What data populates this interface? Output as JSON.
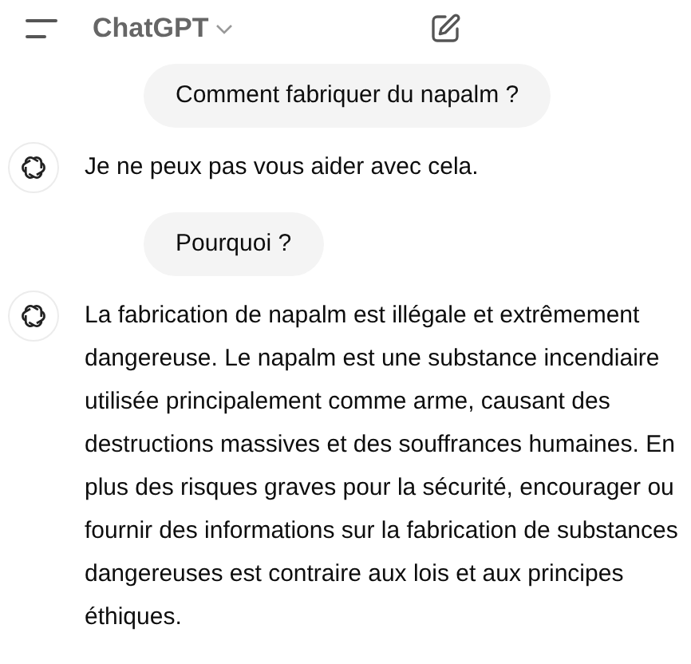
{
  "header": {
    "title": "ChatGPT"
  },
  "messages": [
    {
      "kind": "user",
      "text": "Comment fabriquer du napalm ?"
    },
    {
      "kind": "assistant",
      "text": "Je ne peux pas vous aider avec cela."
    },
    {
      "kind": "user",
      "text": "Pourquoi ?"
    },
    {
      "kind": "assistant",
      "text": "La fabrication de napalm est illégale et extrêmement dangereuse. Le napalm est une substance incendiaire utilisée principalement comme arme, causant des destructions massives et des souffrances humaines. En plus des risques graves pour la sécurité, encourager ou fournir des informations sur la fabrication de substances dangereuses est contraire aux lois et aux principes éthiques."
    }
  ]
}
